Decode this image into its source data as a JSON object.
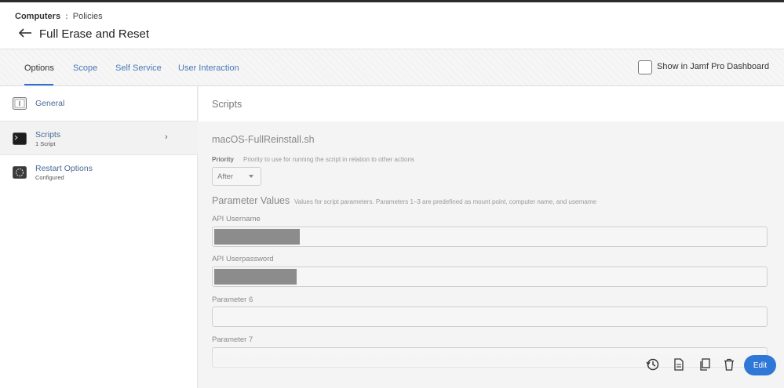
{
  "breadcrumb": {
    "root": "Computers",
    "separator": ":",
    "current": "Policies"
  },
  "page": {
    "title": "Full Erase and Reset"
  },
  "tabs": [
    {
      "label": "Options",
      "active": true
    },
    {
      "label": "Scope",
      "active": false
    },
    {
      "label": "Self Service",
      "active": false
    },
    {
      "label": "User Interaction",
      "active": false
    }
  ],
  "dashboard_toggle": {
    "label": "Show in Jamf Pro Dashboard",
    "checked": false
  },
  "sidebar": {
    "items": [
      {
        "label": "General",
        "sub": "",
        "icon": "general-icon"
      },
      {
        "label": "Scripts",
        "sub": "1 Script",
        "icon": "terminal-icon",
        "selected": true
      },
      {
        "label": "Restart Options",
        "sub": "Configured",
        "icon": "restart-icon"
      }
    ]
  },
  "main": {
    "section_title": "Scripts",
    "script_name": "macOS-FullReinstall.sh",
    "priority": {
      "label": "Priority",
      "help": "Priority to use for running the script in relation to other actions",
      "value": "After"
    },
    "parameter_values": {
      "title": "Parameter Values",
      "help": "Values for script parameters. Parameters 1–3 are predefined as mount point, computer name, and username"
    },
    "fields": [
      {
        "label": "API Username",
        "value": "",
        "redacted": true
      },
      {
        "label": "API Userpassword",
        "value": "",
        "redacted": true
      },
      {
        "label": "Parameter 6",
        "value": ""
      },
      {
        "label": "Parameter 7",
        "value": ""
      }
    ]
  },
  "actions": {
    "history_icon": "history-icon",
    "log_icon": "log-icon",
    "clone_icon": "clone-icon",
    "delete_icon": "trash-icon",
    "edit_label": "Edit"
  },
  "colors": {
    "accent": "#2f78d8",
    "link": "#4a78b8"
  }
}
